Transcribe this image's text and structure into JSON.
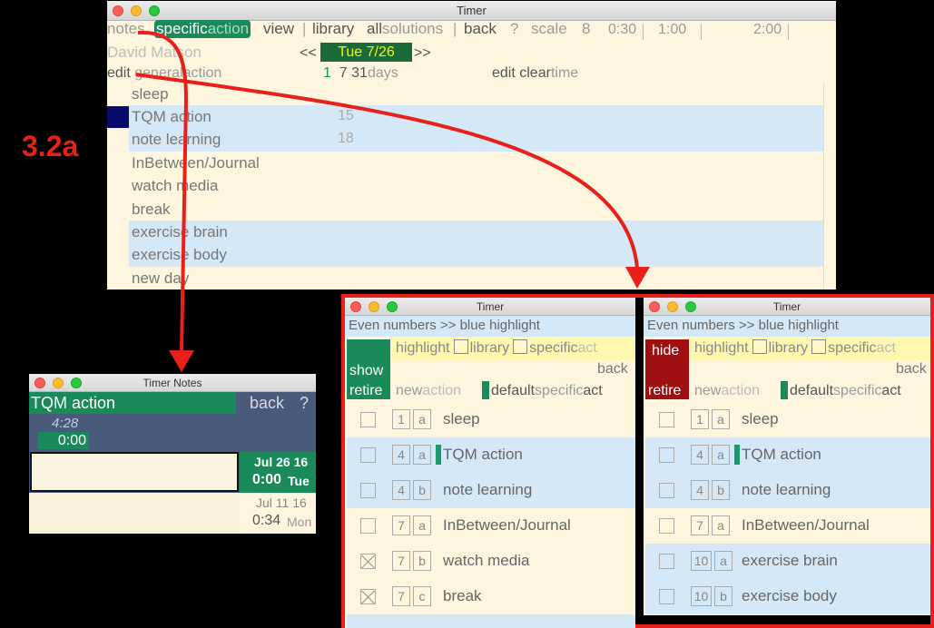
{
  "label_32a": "3.2a",
  "main": {
    "title": "Timer",
    "menu": {
      "notes": "notes",
      "specific": "specific",
      "action": "action",
      "view": "view",
      "sep": "|",
      "library": "library",
      "all": "all",
      "solutions": "solutions",
      "back": "back",
      "help": "?",
      "scale": "scale",
      "scale_value": "8",
      "t030": "0:30",
      "t100": "1:00",
      "t200": "2:00"
    },
    "user": "David Matson",
    "nav_prev": "<<",
    "date": "Tue 7/26",
    "nav_next": ">>",
    "edit_general": {
      "edit": "edit",
      "general": "general",
      "action": "action"
    },
    "days": {
      "d1": "1",
      "d7": "7",
      "d31": "31",
      "label": "days"
    },
    "edit_clear": {
      "edit": "edit",
      "clear": "clear",
      "time": "time"
    },
    "rows": [
      {
        "name": "sleep",
        "num": ""
      },
      {
        "name": "TQM action",
        "num": "15"
      },
      {
        "name": "note learning",
        "num": "18"
      },
      {
        "name": "InBetween/Journal",
        "num": ""
      },
      {
        "name": "watch media",
        "num": ""
      },
      {
        "name": "break",
        "num": ""
      },
      {
        "name": "exercise brain",
        "num": ""
      },
      {
        "name": "exercise body",
        "num": ""
      },
      {
        "name": "new day",
        "num": ""
      }
    ],
    "colors": {
      "selected_marker": "#0a0a6a",
      "blue_row": "#d5e8f7",
      "cream_row": "#fdf5de",
      "date_bg": "#1a6a3a",
      "date_fg": "#fff200"
    }
  },
  "notes": {
    "title": "Timer Notes",
    "action": "TQM action",
    "back": "back",
    "help": "?",
    "elapsed": "4:28",
    "timer": "0:00",
    "entries": [
      {
        "date": "Jul 26 16",
        "time": "0:00",
        "day": "Tue"
      },
      {
        "date": "Jul 11 16",
        "time": "0:34",
        "day": "Mon"
      }
    ]
  },
  "retire_left": {
    "title": "Timer",
    "hint": "Even numbers >> blue highlight",
    "toggle_top": "show",
    "toggle_bottom": "retire",
    "highlight": "highlight",
    "library": "library",
    "specific": "specific",
    "act": "act",
    "back": "back",
    "new": "new",
    "action": "action",
    "default": "default",
    "specific2": "specific",
    "act2": "act",
    "rows": [
      {
        "n": "1",
        "l": "a",
        "name": "sleep",
        "checked": false,
        "mark": false
      },
      {
        "n": "4",
        "l": "a",
        "name": "TQM action",
        "checked": false,
        "mark": true
      },
      {
        "n": "4",
        "l": "b",
        "name": "note learning",
        "checked": false,
        "mark": false
      },
      {
        "n": "7",
        "l": "a",
        "name": "InBetween/Journal",
        "checked": false,
        "mark": false
      },
      {
        "n": "7",
        "l": "b",
        "name": "watch media",
        "checked": true,
        "mark": false
      },
      {
        "n": "7",
        "l": "c",
        "name": "break",
        "checked": true,
        "mark": false
      }
    ]
  },
  "retire_right": {
    "title": "Timer",
    "hint": "Even numbers >> blue highlight",
    "toggle_top": "hide",
    "toggle_bottom": "retire",
    "highlight": "highlight",
    "library": "library",
    "specific": "specific",
    "act": "act",
    "back": "back",
    "new": "new",
    "action": "action",
    "default": "default",
    "specific2": "specific",
    "act2": "act",
    "rows": [
      {
        "n": "1",
        "l": "a",
        "name": "sleep",
        "checked": false,
        "mark": false
      },
      {
        "n": "4",
        "l": "a",
        "name": "TQM action",
        "checked": false,
        "mark": true
      },
      {
        "n": "4",
        "l": "b",
        "name": "note learning",
        "checked": false,
        "mark": false
      },
      {
        "n": "7",
        "l": "a",
        "name": "InBetween/Journal",
        "checked": false,
        "mark": false
      },
      {
        "n": "10",
        "l": "a",
        "name": "exercise brain",
        "checked": false,
        "mark": false
      },
      {
        "n": "10",
        "l": "b",
        "name": "exercise body",
        "checked": false,
        "mark": false
      }
    ]
  }
}
